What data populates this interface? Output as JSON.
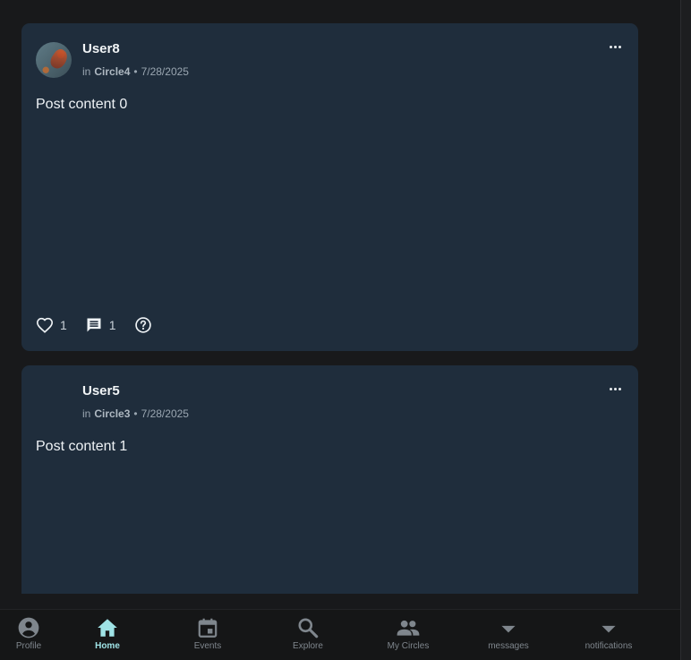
{
  "posts": [
    {
      "username": "User8",
      "circle_prefix": "in",
      "circle": "Circle4",
      "separator": "•",
      "date": "7/28/2025",
      "content": "Post content 0",
      "likes": "1",
      "comments": "1",
      "has_avatar_image": true
    },
    {
      "username": "User5",
      "circle_prefix": "in",
      "circle": "Circle3",
      "separator": "•",
      "date": "7/28/2025",
      "content": "Post content 1",
      "has_avatar_image": false
    }
  ],
  "nav": {
    "items": [
      {
        "label": "Profile",
        "icon": "account-circle-icon",
        "active": false
      },
      {
        "label": "Home",
        "icon": "home-icon",
        "active": true
      },
      {
        "label": "Events",
        "icon": "calendar-icon",
        "active": false
      },
      {
        "label": "Explore",
        "icon": "search-icon",
        "active": false
      },
      {
        "label": "My Circles",
        "icon": "people-icon",
        "active": false
      },
      {
        "label": "messages",
        "icon": "caret-down-icon",
        "active": false
      },
      {
        "label": "notifications",
        "icon": "caret-down-icon",
        "active": false
      }
    ],
    "active_color": "#9fe3e6",
    "inactive_color": "#7f868d"
  },
  "colors": {
    "card": "#1f2d3c",
    "background": "#18191b"
  }
}
